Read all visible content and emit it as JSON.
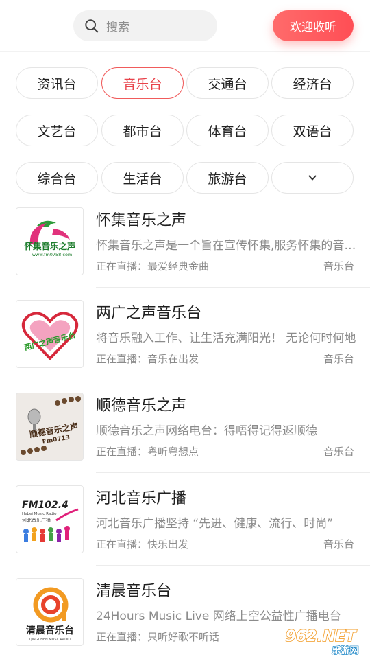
{
  "header": {
    "search_placeholder": "搜索",
    "welcome_label": "欢迎收听"
  },
  "categories": [
    {
      "label": "资讯台",
      "active": false
    },
    {
      "label": "音乐台",
      "active": true
    },
    {
      "label": "交通台",
      "active": false
    },
    {
      "label": "经济台",
      "active": false
    },
    {
      "label": "文艺台",
      "active": false
    },
    {
      "label": "都市台",
      "active": false
    },
    {
      "label": "体育台",
      "active": false
    },
    {
      "label": "双语台",
      "active": false
    },
    {
      "label": "综合台",
      "active": false
    },
    {
      "label": "生活台",
      "active": false
    },
    {
      "label": "旅游台",
      "active": false
    },
    {
      "label": "",
      "icon": "chevron-down-icon",
      "active": false
    }
  ],
  "stations": [
    {
      "title": "怀集音乐之声",
      "desc": "怀集音乐之声是一个旨在宣传怀集,服务怀集的音乐电台",
      "live": "正在直播：最爱经典金曲",
      "tag": "音乐台",
      "logo": {
        "text": "怀集音乐之声",
        "sub": "www.fm0758.com"
      }
    },
    {
      "title": "两广之声音乐台",
      "desc": "将音乐融入工作、让生活充满阳光！ 无论何时何地",
      "live": "正在直播：音乐在出发",
      "tag": "音乐台",
      "logo": {
        "text": "两广之声音乐台"
      }
    },
    {
      "title": "顺德音乐之声",
      "desc": "顺德音乐之声网络电台：得唔得记得返顺德",
      "live": "正在直播：粤听粤想点",
      "tag": "音乐台",
      "logo": {
        "text": "顺德音乐之声",
        "sub": "Fm0713"
      }
    },
    {
      "title": "河北音乐广播",
      "desc": "河北音乐广播坚持 “先进、健康、流行、时尚”",
      "live": "正在直播：快乐出发",
      "tag": "音乐台",
      "logo": {
        "text": "FM102.4",
        "sub": "Hebei Music Radio",
        "sub2": "河北音乐广播"
      }
    },
    {
      "title": "清晨音乐台",
      "desc": "24Hours Music Live 网络上空公益性广播电台",
      "live": "正在直播：只听好歌不听话",
      "tag": "音乐台",
      "logo": {
        "text": "清晨音乐台",
        "sub": "QINGCHEN MUSICRADIO"
      }
    }
  ],
  "watermark": {
    "text": "962.NET",
    "sub": "乐游网"
  },
  "colors": {
    "accent": "#e8434b",
    "welcome_gradient_start": "#ff6b6b",
    "welcome_gradient_end": "#ff4e55",
    "muted": "#8b8b8b"
  }
}
